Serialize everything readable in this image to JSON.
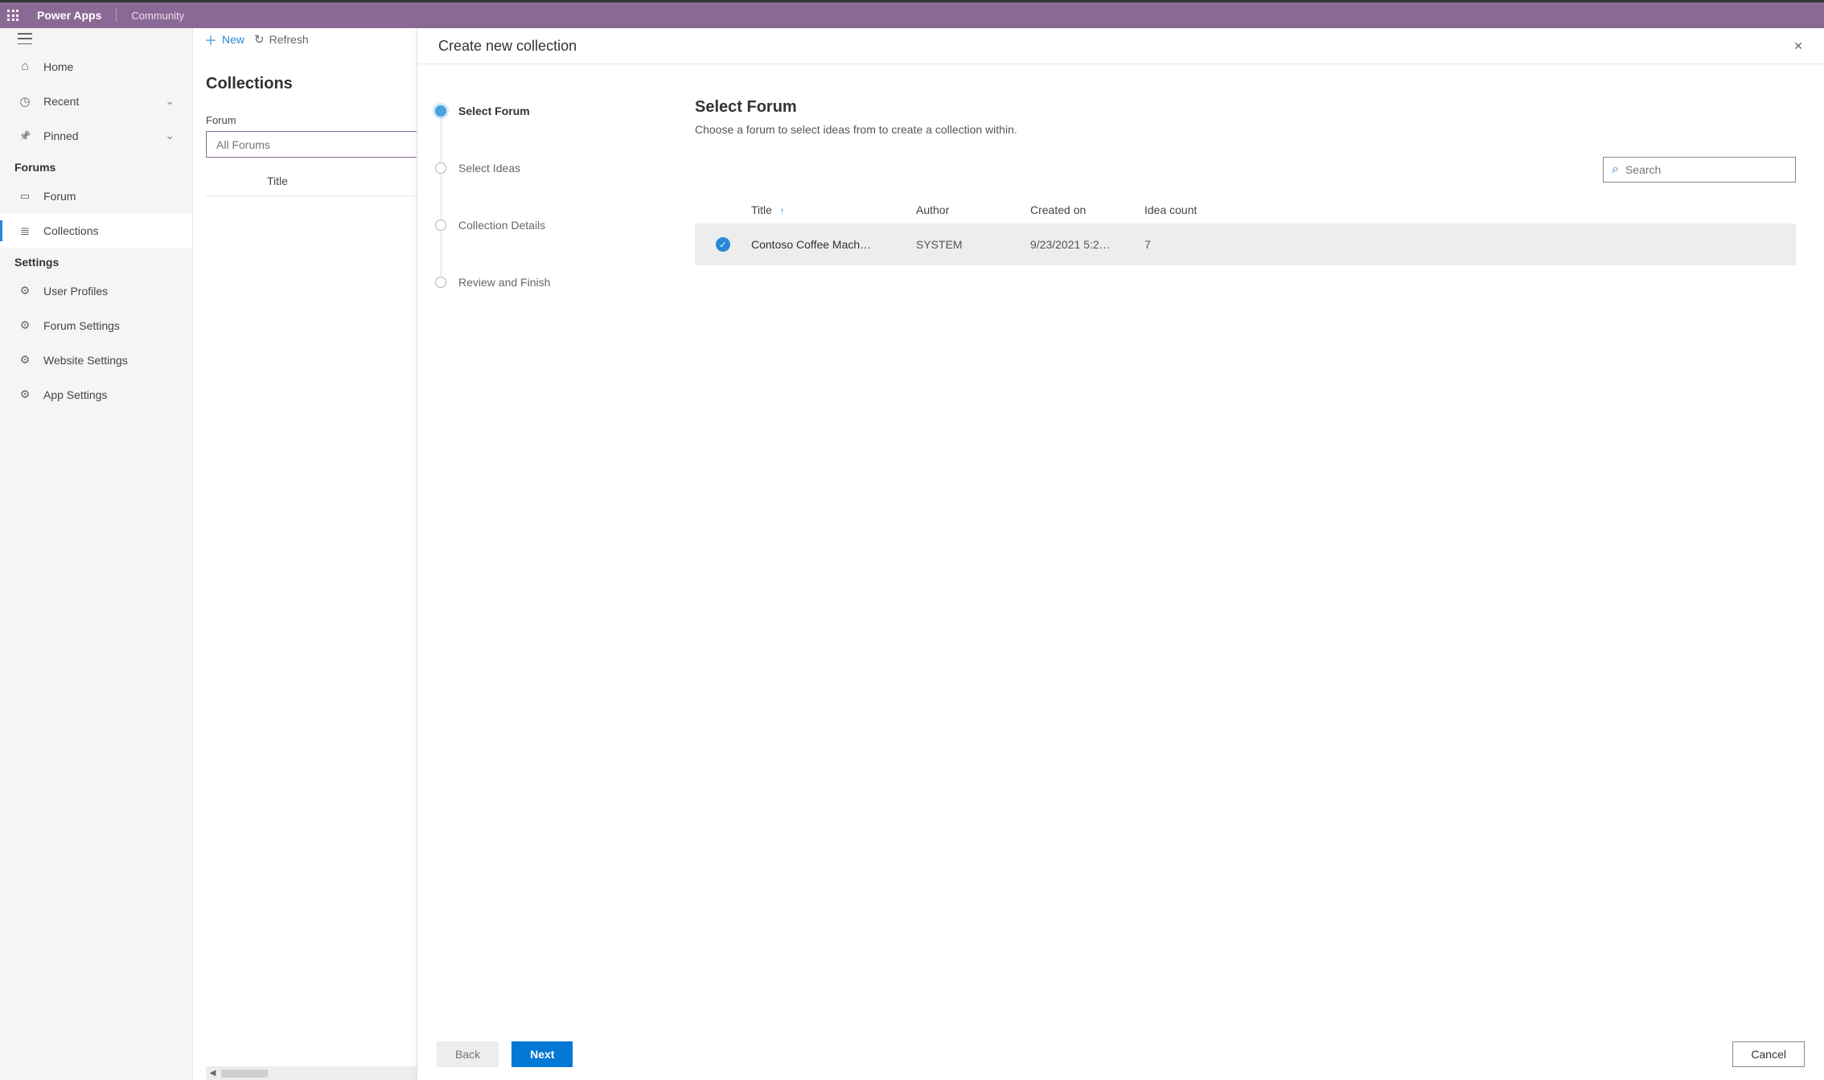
{
  "header": {
    "app": "Power Apps",
    "sub": "Community"
  },
  "nav": {
    "home": "Home",
    "recent": "Recent",
    "pinned": "Pinned",
    "sections": {
      "forums": "Forums",
      "settings": "Settings"
    },
    "forum": "Forum",
    "collections": "Collections",
    "user_profiles": "User Profiles",
    "forum_settings": "Forum Settings",
    "website_settings": "Website Settings",
    "app_settings": "App Settings"
  },
  "toolbar": {
    "new": "New",
    "refresh": "Refresh"
  },
  "midpage": {
    "heading": "Collections",
    "forum_label": "Forum",
    "forum_value": "All Forums",
    "title_col": "Title"
  },
  "panel": {
    "title": "Create new collection",
    "steps": {
      "s1": "Select Forum",
      "s2": "Select Ideas",
      "s3": "Collection Details",
      "s4": "Review and Finish"
    },
    "main": {
      "heading": "Select Forum",
      "sub": "Choose a forum to select ideas from to create a collection within.",
      "search_placeholder": "Search"
    },
    "grid": {
      "cols": {
        "title": "Title",
        "author": "Author",
        "created": "Created on",
        "ideas": "Idea count"
      },
      "rows": [
        {
          "title": "Contoso Coffee Mach…",
          "author": "SYSTEM",
          "created": "9/23/2021 5:2…",
          "ideas": "7"
        }
      ]
    },
    "footer": {
      "back": "Back",
      "next": "Next",
      "cancel": "Cancel"
    }
  }
}
